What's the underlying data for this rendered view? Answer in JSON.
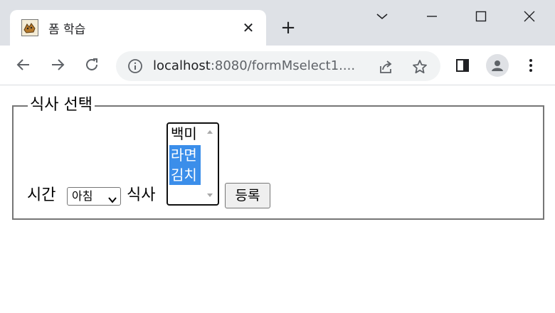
{
  "browser": {
    "tab": {
      "title": "폼 학습",
      "favicon": "tomcat-icon",
      "close": "✕"
    },
    "new_tab": "+",
    "window_controls": [
      "chevron-down-icon",
      "minimize-icon",
      "maximize-icon",
      "close-icon"
    ],
    "url_host": "localhost",
    "url_rest": ":8080/formMselect1...."
  },
  "form": {
    "legend": "식사 선택",
    "time_label": "시간",
    "time_select_value": "아침",
    "meal_label": "식사",
    "meal_options": [
      {
        "label": "백미",
        "selected": false
      },
      {
        "label": "라면",
        "selected": true
      },
      {
        "label": "김치",
        "selected": true
      }
    ],
    "submit_label": "등록"
  },
  "colors": {
    "selection": "#3b8eea",
    "tabstrip": "#dee1e6",
    "omnibox": "#f1f3f4"
  }
}
